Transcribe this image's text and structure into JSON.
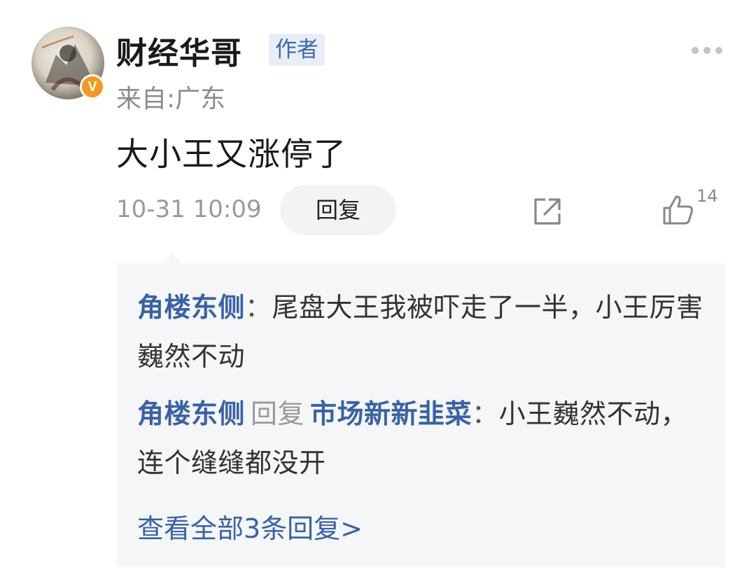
{
  "post": {
    "author_name": "财经华哥",
    "author_tag": "作者",
    "verified_badge": "V",
    "location": "来自:广东",
    "content": "大小王又涨停了",
    "timestamp": "10-31 10:09",
    "reply_button": "回复",
    "like_count": "14",
    "icons": {
      "more": "more-dots-icon",
      "share": "share-external-icon",
      "like": "thumbs-up-icon"
    }
  },
  "replies": {
    "items": [
      {
        "user": "角楼东侧",
        "separator": "：",
        "text": "尾盘大王我被吓走了一半，小王厉害巍然不动"
      },
      {
        "user": "角楼东侧",
        "reply_word": "回复",
        "target": "市场新新韭菜",
        "separator": "：",
        "text": "小王巍然不动，连个缝缝都没开"
      }
    ],
    "view_all": "查看全部3条回复>"
  },
  "colors": {
    "link_blue": "#3862a8",
    "tag_bg": "#e9eef6",
    "badge_orange": "#f39a1e",
    "reply_bg": "#f5f6f7"
  }
}
